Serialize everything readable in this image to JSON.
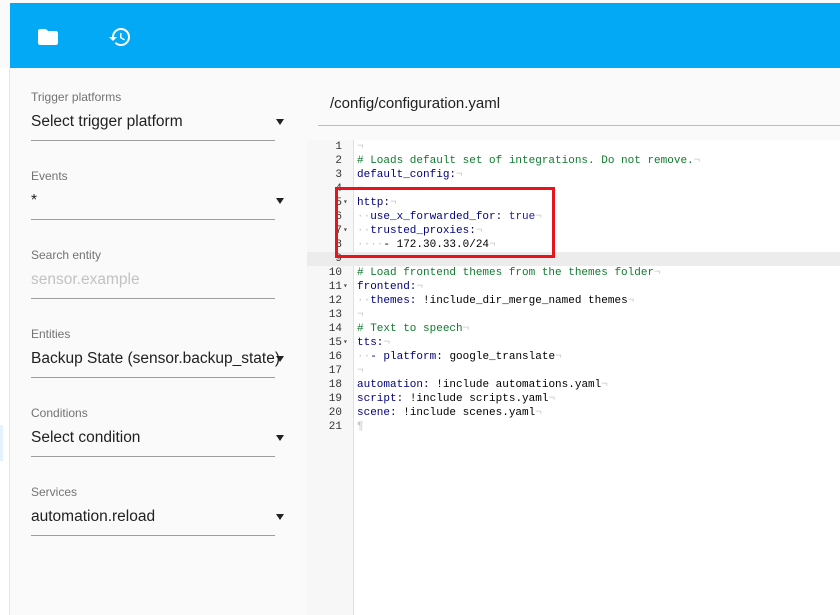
{
  "toolbar": {
    "folder_icon": "folder-icon",
    "history_icon": "history-icon",
    "background": "#03a9f4"
  },
  "sidebar": {
    "fields": [
      {
        "label": "Trigger platforms",
        "value": "Select trigger platform"
      },
      {
        "label": "Events",
        "value": "*"
      },
      {
        "label": "Search entity",
        "placeholder": "sensor.example"
      },
      {
        "label": "Entities",
        "value": "Backup State (sensor.backup_state)"
      },
      {
        "label": "Conditions",
        "value": "Select condition"
      },
      {
        "label": "Services",
        "value": "automation.reload"
      }
    ]
  },
  "editor": {
    "file_path": "/config/configuration.yaml",
    "active_line": 9,
    "lines": [
      {
        "n": "1",
        "fold": ""
      },
      {
        "n": "2",
        "fold": ""
      },
      {
        "n": "3",
        "fold": ""
      },
      {
        "n": "4",
        "fold": ""
      },
      {
        "n": "5",
        "fold": "▾"
      },
      {
        "n": "6",
        "fold": ""
      },
      {
        "n": "7",
        "fold": "▾"
      },
      {
        "n": "8",
        "fold": ""
      },
      {
        "n": "9",
        "fold": ""
      },
      {
        "n": "10",
        "fold": ""
      },
      {
        "n": "11",
        "fold": "▾"
      },
      {
        "n": "12",
        "fold": ""
      },
      {
        "n": "13",
        "fold": ""
      },
      {
        "n": "14",
        "fold": ""
      },
      {
        "n": "15",
        "fold": "▾"
      },
      {
        "n": "16",
        "fold": ""
      },
      {
        "n": "17",
        "fold": ""
      },
      {
        "n": "18",
        "fold": ""
      },
      {
        "n": "19",
        "fold": ""
      },
      {
        "n": "20",
        "fold": ""
      },
      {
        "n": "21",
        "fold": ""
      }
    ],
    "code": {
      "l2_comment": "# Loads default set of integrations. Do not remove.",
      "l3_key": "default_config:",
      "l5_key": "http:",
      "l6_key": "use_x_forwarded_for:",
      "l6_value": "true",
      "l7_key": "trusted_proxies:",
      "l8_value": "- 172.30.33.0/24",
      "l10_comment": "# Load frontend themes from the themes folder",
      "l11_key": "frontend:",
      "l12_key": "themes:",
      "l12_value": "!include_dir_merge_named themes",
      "l14_comment": "# Text to speech",
      "l15_key": "tts:",
      "l16_key": "- platform:",
      "l16_value": "google_translate",
      "l18_key": "automation:",
      "l18_value": "!include automations.yaml",
      "l19_key": "script:",
      "l19_value": "!include scripts.yaml",
      "l20_key": "scene:",
      "l20_value": "!include scenes.yaml"
    },
    "whitespace_marks": {
      "eol": "¬",
      "eof": "¶",
      "indent2": "··",
      "indent4": "····"
    },
    "annotation_color": "#e8141b"
  }
}
